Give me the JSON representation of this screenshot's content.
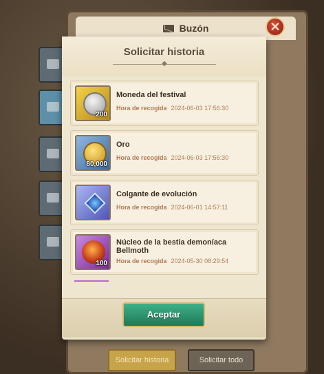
{
  "mailbox": {
    "title": "Buzón",
    "close_icon": "close-x",
    "side_tabs": [
      "tab-1",
      "tab-mail",
      "tab-3",
      "tab-4",
      "tab-5"
    ]
  },
  "dialog": {
    "title": "Solicitar historia",
    "items": [
      {
        "name": "Moneda del festival",
        "qty": "200",
        "time_label": "Hora de recogida",
        "time": "2024-06-03 17:56:30",
        "icon": "silver-coin-icon"
      },
      {
        "name": "Oro",
        "qty": "80,000",
        "time_label": "Hora de recogida",
        "time": "2024-06-03 17:56:30",
        "icon": "gold-coin-icon"
      },
      {
        "name": "Colgante de evolución",
        "qty": "",
        "time_label": "Hora de recogida",
        "time": "2024-06-01 14:57:11",
        "icon": "pendant-icon"
      },
      {
        "name": "Núcleo de la bestia demoníaca Bellmoth",
        "qty": "100",
        "time_label": "Hora de recogida",
        "time": "2024-05-30 08:29:54",
        "icon": "core-icon"
      }
    ],
    "accept_label": "Aceptar"
  },
  "footer": {
    "history_label": "Solicitar historia",
    "all_label": "Solicitar todo"
  },
  "colors": {
    "accept_green": "#1f7a58",
    "time_text": "#b07a52",
    "history_btn": "#c7a34a"
  }
}
